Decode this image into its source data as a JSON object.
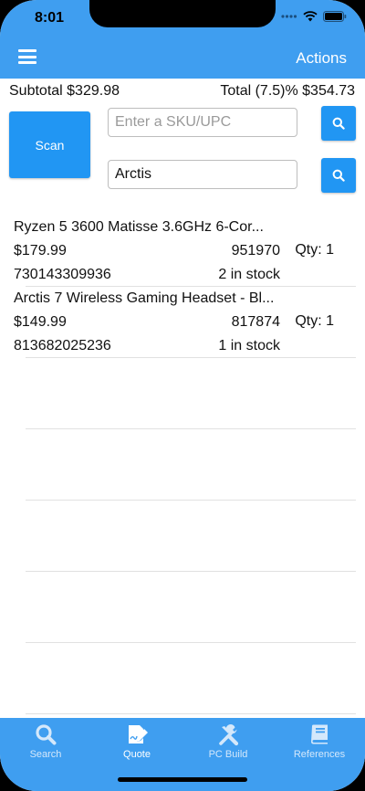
{
  "status": {
    "time": "8:01"
  },
  "header": {
    "actions_label": "Actions"
  },
  "totals": {
    "subtotal": "Subtotal $329.98",
    "total": "Total (7.5)% $354.73"
  },
  "scan": {
    "label": "Scan"
  },
  "sku_search": {
    "placeholder": "Enter a SKU/UPC",
    "value": ""
  },
  "name_search": {
    "value": "Arctis"
  },
  "items": [
    {
      "name": "Ryzen 5 3600 Matisse 3.6GHz 6-Cor...",
      "price": "$179.99",
      "sku": "951970",
      "qty": "Qty: 1",
      "upc": "730143309936",
      "stock": "2 in stock"
    },
    {
      "name": "Arctis 7 Wireless Gaming Headset - Bl...",
      "price": "$149.99",
      "sku": "817874",
      "qty": "Qty: 1",
      "upc": "813682025236",
      "stock": "1 in stock"
    }
  ],
  "tabs": [
    {
      "label": "Search",
      "icon": "search-icon"
    },
    {
      "label": "Quote",
      "icon": "quote-icon",
      "active": true
    },
    {
      "label": "PC Build",
      "icon": "tools-icon"
    },
    {
      "label": "References",
      "icon": "book-icon"
    }
  ],
  "colors": {
    "accent": "#3f9ef0",
    "button": "#2196f3"
  }
}
